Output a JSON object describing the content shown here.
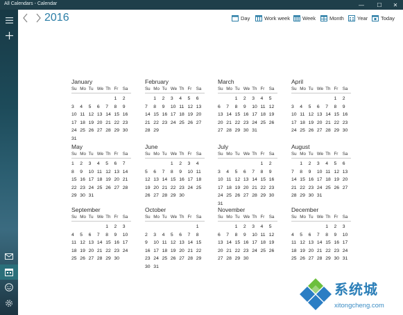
{
  "window": {
    "title": "All Calendars - Calendar",
    "controls": [
      "—",
      "☐",
      "✕"
    ]
  },
  "header": {
    "year": "2016"
  },
  "views": [
    {
      "label": "Day",
      "icon": "day-view-icon"
    },
    {
      "label": "Work week",
      "icon": "work-week-view-icon"
    },
    {
      "label": "Week",
      "icon": "week-view-icon"
    },
    {
      "label": "Month",
      "icon": "month-view-icon"
    },
    {
      "label": "Year",
      "icon": "year-view-icon"
    },
    {
      "label": "Today",
      "icon": "today-icon"
    }
  ],
  "weekdays": [
    "Su",
    "Mo",
    "Tu",
    "We",
    "Th",
    "Fr",
    "Sa"
  ],
  "months": [
    {
      "name": "January",
      "lead": 5,
      "days": 31
    },
    {
      "name": "February",
      "lead": 1,
      "days": 29
    },
    {
      "name": "March",
      "lead": 2,
      "days": 31
    },
    {
      "name": "April",
      "lead": 5,
      "days": 30
    },
    {
      "name": "May",
      "lead": 0,
      "days": 31
    },
    {
      "name": "June",
      "lead": 3,
      "days": 30
    },
    {
      "name": "July",
      "lead": 5,
      "days": 31
    },
    {
      "name": "August",
      "lead": 1,
      "days": 31
    },
    {
      "name": "September",
      "lead": 4,
      "days": 30
    },
    {
      "name": "October",
      "lead": 6,
      "days": 31
    },
    {
      "name": "November",
      "lead": 2,
      "days": 30
    },
    {
      "name": "December",
      "lead": 4,
      "days": 31
    }
  ],
  "watermark": {
    "brand": "系统城",
    "url": "xitongcheng.com"
  }
}
